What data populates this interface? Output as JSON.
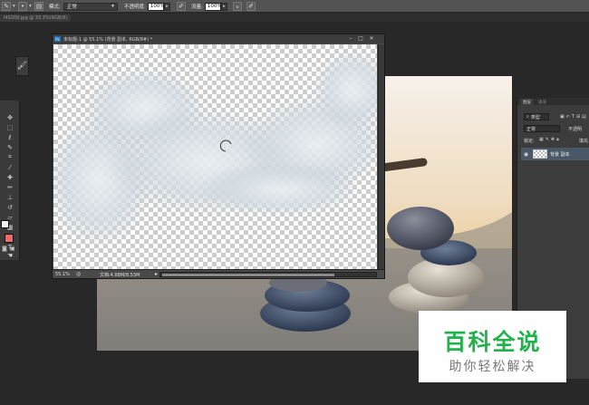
{
  "options_bar": {
    "mode_label": "模式:",
    "mode_value": "正常",
    "opacity_label": "不透明度:",
    "opacity_value": "100%",
    "flow_label": "流量:",
    "flow_value": "100%"
  },
  "doc_tab": {
    "label": "l40209.jpg @ 33.3%(RGB/8)"
  },
  "document_window": {
    "title": "未标题-1 @ 55.1% (背景 副本, RGB/8#) *",
    "zoom": "55.1%",
    "doc_info": "文档:4.88M/8.53M"
  },
  "layers_panel": {
    "tabs": [
      "图层",
      "通道"
    ],
    "filter_label": "类型",
    "blend_mode": "正常",
    "opacity_label": "不透明",
    "lock_label": "锁定:",
    "fill_label": "填充",
    "layers": [
      {
        "name": "背景 副本"
      }
    ]
  },
  "watermark": {
    "title": "百科全说",
    "subtitle": "助你轻松解决"
  },
  "colors": {
    "foreground": "#f2f2f2",
    "background": "#ee6b6b",
    "brand_green": "#22b24c"
  }
}
